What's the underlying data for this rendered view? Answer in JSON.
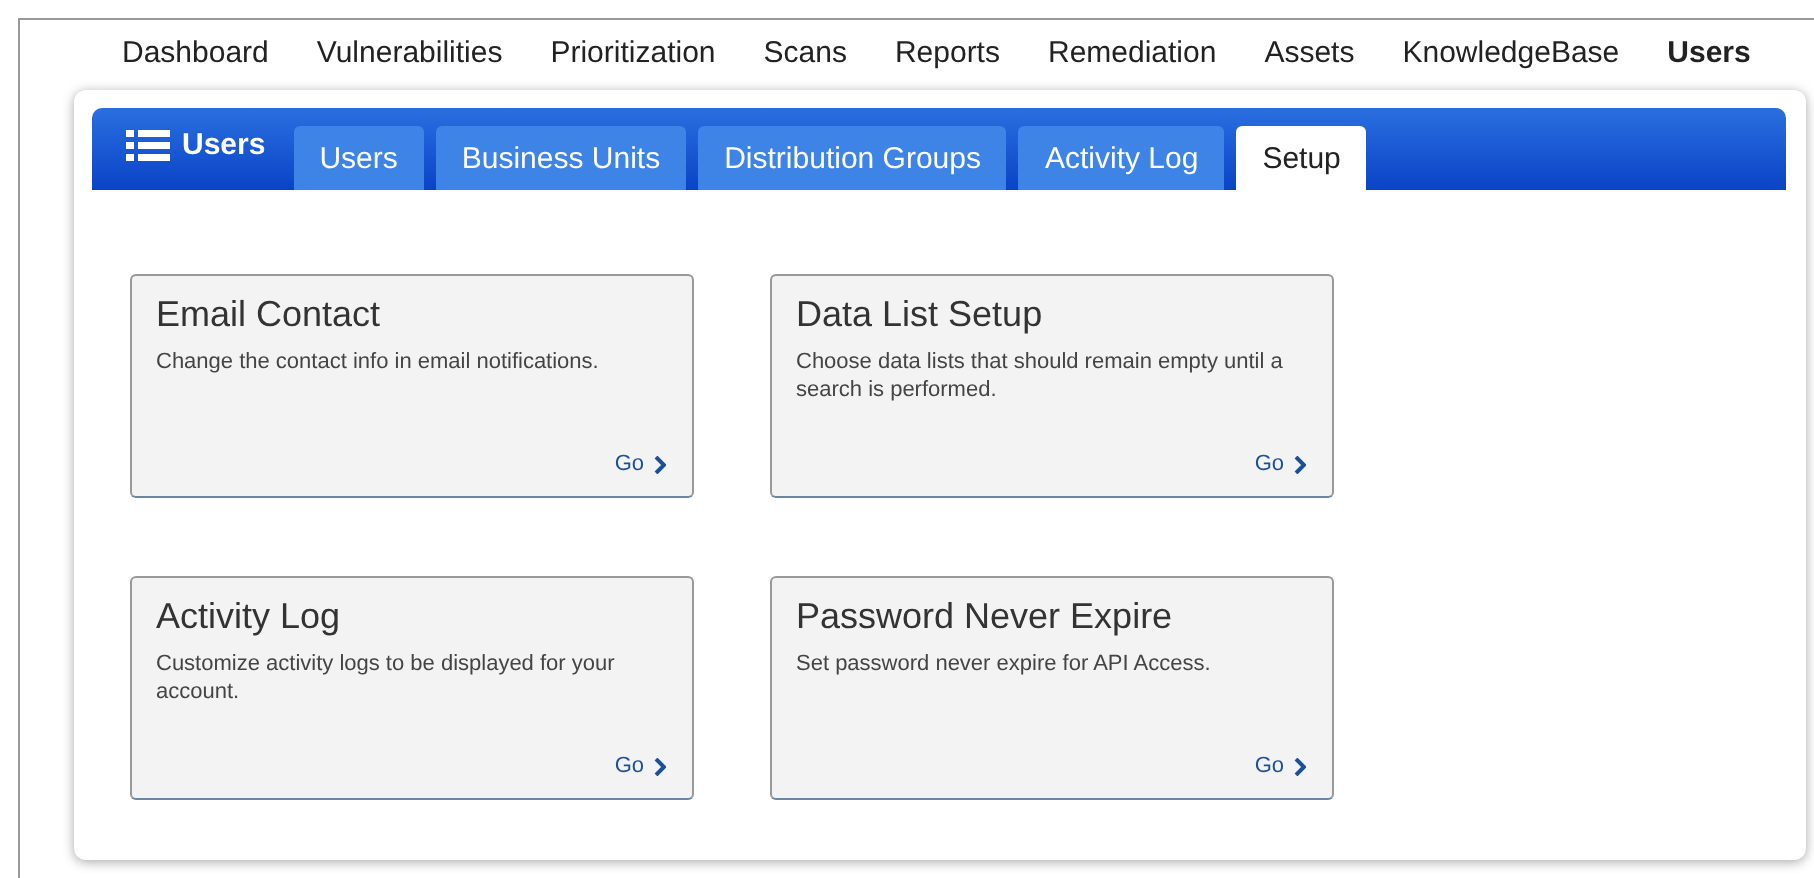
{
  "top_nav": [
    {
      "label": "Dashboard",
      "selected": false
    },
    {
      "label": "Vulnerabilities",
      "selected": false
    },
    {
      "label": "Prioritization",
      "selected": false
    },
    {
      "label": "Scans",
      "selected": false
    },
    {
      "label": "Reports",
      "selected": false
    },
    {
      "label": "Remediation",
      "selected": false
    },
    {
      "label": "Assets",
      "selected": false
    },
    {
      "label": "KnowledgeBase",
      "selected": false
    },
    {
      "label": "Users",
      "selected": true
    }
  ],
  "module_title": "Users",
  "tabs": [
    {
      "label": "Users",
      "selected": false
    },
    {
      "label": "Business Units",
      "selected": false
    },
    {
      "label": "Distribution Groups",
      "selected": false
    },
    {
      "label": "Activity Log",
      "selected": false
    },
    {
      "label": "Setup",
      "selected": true
    }
  ],
  "cards": [
    {
      "title": "Email Contact",
      "description": "Change the contact info in email notifications.",
      "link": "Go"
    },
    {
      "title": "Data List Setup",
      "description": "Choose data lists that should remain empty until a search is performed.",
      "link": "Go"
    },
    {
      "title": "Activity Log",
      "description": "Customize activity logs to be displayed for your account.",
      "link": "Go"
    },
    {
      "title": "Password Never Expire",
      "description": "Set password never expire for API Access.",
      "link": "Go"
    }
  ]
}
